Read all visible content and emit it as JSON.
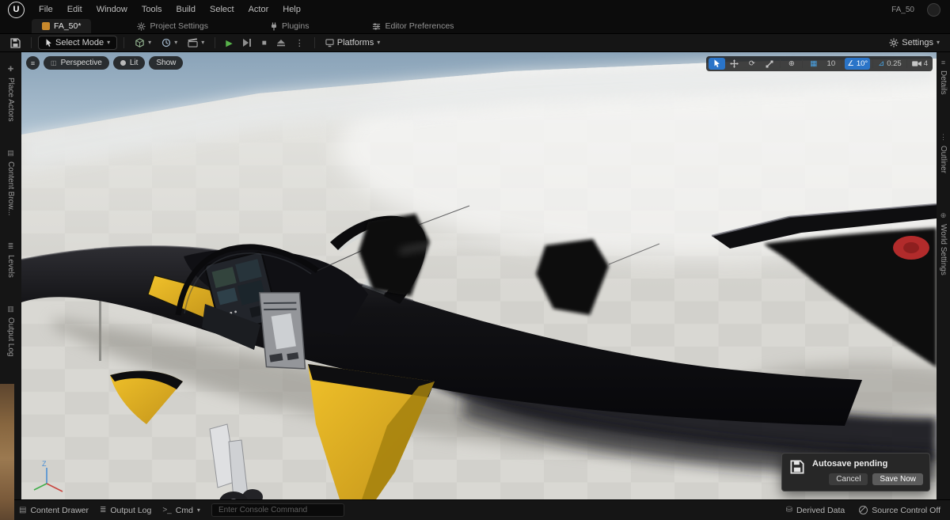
{
  "menubar": {
    "items": [
      "File",
      "Edit",
      "Window",
      "Tools",
      "Build",
      "Select",
      "Actor",
      "Help"
    ],
    "project_badge": "FA_50"
  },
  "tabs": {
    "active_label": "FA_50*",
    "items": [
      {
        "label": "Project Settings"
      },
      {
        "label": "Plugins"
      },
      {
        "label": "Editor Preferences"
      }
    ]
  },
  "toolbar": {
    "select_mode": "Select Mode",
    "platforms": "Platforms",
    "settings": "Settings"
  },
  "rails": {
    "left": [
      "Place Actors",
      "Content Brow...",
      "Levels",
      "Output Log"
    ],
    "right": [
      "Details",
      "Outliner",
      "World Settings"
    ]
  },
  "viewport": {
    "pills": {
      "perspective": "Perspective",
      "lit": "Lit",
      "show": "Show"
    },
    "snaps": {
      "grid": "10",
      "rotation": "10°",
      "scale": "0.25",
      "camera_speed": "4"
    },
    "axis": "Z"
  },
  "autosave": {
    "title": "Autosave pending",
    "cancel": "Cancel",
    "save_now": "Save Now"
  },
  "statusbar": {
    "content_drawer": "Content Drawer",
    "output_log": "Output Log",
    "cmd": "Cmd",
    "console_placeholder": "Enter Console Command",
    "derived_data": "Derived Data",
    "source_control": "Source Control Off"
  },
  "colors": {
    "accent": "#2a74c8",
    "play_green": "#58b24b",
    "ue_orange": "#c9892c",
    "jet_yellow": "#e0ac1e",
    "roundel_red": "#b22b2b"
  }
}
